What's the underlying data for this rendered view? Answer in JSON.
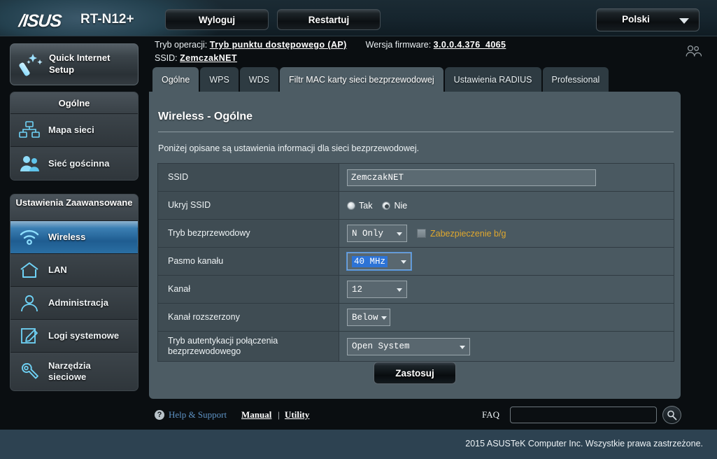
{
  "topbar": {
    "brand": "/ISUS",
    "model": "RT-N12+",
    "logout_label": "Wyloguj",
    "reboot_label": "Restartuj",
    "language": "Polski"
  },
  "infoband": {
    "operation_mode_label": "Tryb operacji:",
    "operation_mode_value": "Tryb punktu dostępowego (AP)",
    "firmware_label": "Wersja firmware:",
    "firmware_value": "3.0.0.4.376_4065",
    "ssid_label": "SSID:",
    "ssid_value": "ZemczakNET"
  },
  "sidebar": {
    "quick_setup": "Quick Internet Setup",
    "groups": [
      {
        "title": "Ogólne",
        "items": [
          {
            "label": "Mapa sieci",
            "icon": "network-map-icon",
            "active": false
          },
          {
            "label": "Sieć gościnna",
            "icon": "guest-network-icon",
            "active": false
          }
        ]
      },
      {
        "title": "Ustawienia Zaawansowane",
        "items": [
          {
            "label": "Wireless",
            "icon": "wifi-icon",
            "active": true
          },
          {
            "label": "LAN",
            "icon": "home-icon",
            "active": false
          },
          {
            "label": "Administracja",
            "icon": "user-icon",
            "active": false
          },
          {
            "label": "Logi systemowe",
            "icon": "log-icon",
            "active": false
          },
          {
            "label": "Narzędzia sieciowe",
            "icon": "wrench-icon",
            "active": false
          }
        ]
      }
    ]
  },
  "tabs": [
    {
      "label": "Ogólne",
      "state": "active"
    },
    {
      "label": "WPS",
      "state": "normal"
    },
    {
      "label": "WDS",
      "state": "normal"
    },
    {
      "label": "Filtr MAC karty sieci bezprzewodowej",
      "state": "hover"
    },
    {
      "label": "Ustawienia RADIUS",
      "state": "normal"
    },
    {
      "label": "Professional",
      "state": "normal"
    }
  ],
  "panel": {
    "title": "Wireless - Ogólne",
    "description": "Poniżej opisane są ustawienia informacji dla sieci bezprzewodowej.",
    "apply_label": "Zastosuj",
    "rows": {
      "ssid": {
        "label": "SSID",
        "value": "ZemczakNET"
      },
      "hide_ssid": {
        "label": "Ukryj SSID",
        "options": [
          {
            "label": "Tak",
            "selected": false
          },
          {
            "label": "Nie",
            "selected": true
          }
        ]
      },
      "wireless_mode": {
        "label": "Tryb bezprzewodowy",
        "value": "N Only",
        "checkbox_label": "Zabezpieczenie b/g",
        "checkbox_checked": false
      },
      "bandwidth": {
        "label": "Pasmo kanału",
        "value": "40 MHz",
        "focused": true
      },
      "channel": {
        "label": "Kanał",
        "value": "12"
      },
      "extension_channel": {
        "label": "Kanał rozszerzony",
        "value": "Below"
      },
      "auth_method": {
        "label": "Tryb autentykacji połączenia bezprzewodowego",
        "value": "Open System"
      }
    }
  },
  "footer": {
    "help_support": "Help & Support",
    "manual": "Manual",
    "separator": "|",
    "utility": "Utility",
    "faq_label": "FAQ",
    "faq_value": "",
    "faq_placeholder": ""
  },
  "copyright": "2015 ASUSTeK Computer Inc. Wszystkie prawa zastrzeżone.",
  "colors": {
    "accent_blue": "#2a6ea3",
    "panel_bg": "#4d5c64",
    "warning_orange": "#e0a82e",
    "link_blue": "#5e92c4",
    "copyright_bar": "#2d4251"
  }
}
